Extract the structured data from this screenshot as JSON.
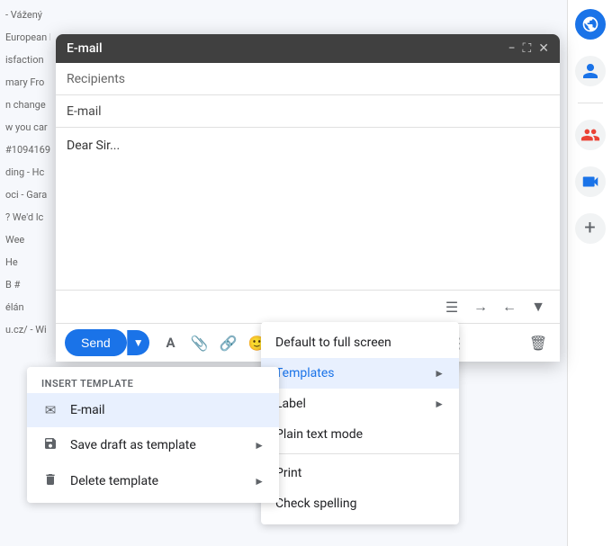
{
  "background": {
    "snippets": [
      "- Vážený",
      "European B",
      "isfaction",
      "mary Fro",
      "n change",
      "w you car",
      "#1094169",
      "ding - Hc",
      "oci - Gara",
      "? We'd lc",
      "Wee",
      "He",
      "B #",
      "élán",
      "u.cz/ - Wi"
    ]
  },
  "sidebar": {
    "icons": [
      {
        "name": "user-icon",
        "type": "user",
        "color": "#1a73e8"
      },
      {
        "name": "people-icon",
        "type": "people",
        "color": "#ea4335"
      },
      {
        "name": "meet-icon",
        "type": "meet",
        "color": "#1a73e8"
      },
      {
        "name": "plus-icon",
        "type": "plus",
        "color": "#5f6368"
      }
    ]
  },
  "compose": {
    "title": "E-mail",
    "recipients_label": "Recipients",
    "email_label": "E-mail",
    "greeting": "Dear Sir...",
    "send_label": "Send",
    "toolbar_icons": [
      "format-bold",
      "attach-file",
      "link",
      "emoji",
      "drive",
      "photo",
      "lock",
      "pencil",
      "more-options"
    ]
  },
  "context_menu": {
    "items": [
      {
        "label": "Default to full screen",
        "has_arrow": false
      },
      {
        "label": "Templates",
        "has_arrow": true,
        "active": true
      },
      {
        "label": "Label",
        "has_arrow": true
      },
      {
        "label": "Plain text mode",
        "has_arrow": false
      },
      {
        "label": "Print",
        "has_arrow": false
      },
      {
        "label": "Check spelling",
        "has_arrow": false
      }
    ]
  },
  "insert_template": {
    "header": "INSERT TEMPLATE",
    "items": [
      {
        "label": "E-mail",
        "icon": "email",
        "has_arrow": false
      },
      {
        "label": "Save draft as template",
        "icon": "save",
        "has_arrow": true
      },
      {
        "label": "Delete template",
        "icon": "delete",
        "has_arrow": true
      }
    ]
  }
}
